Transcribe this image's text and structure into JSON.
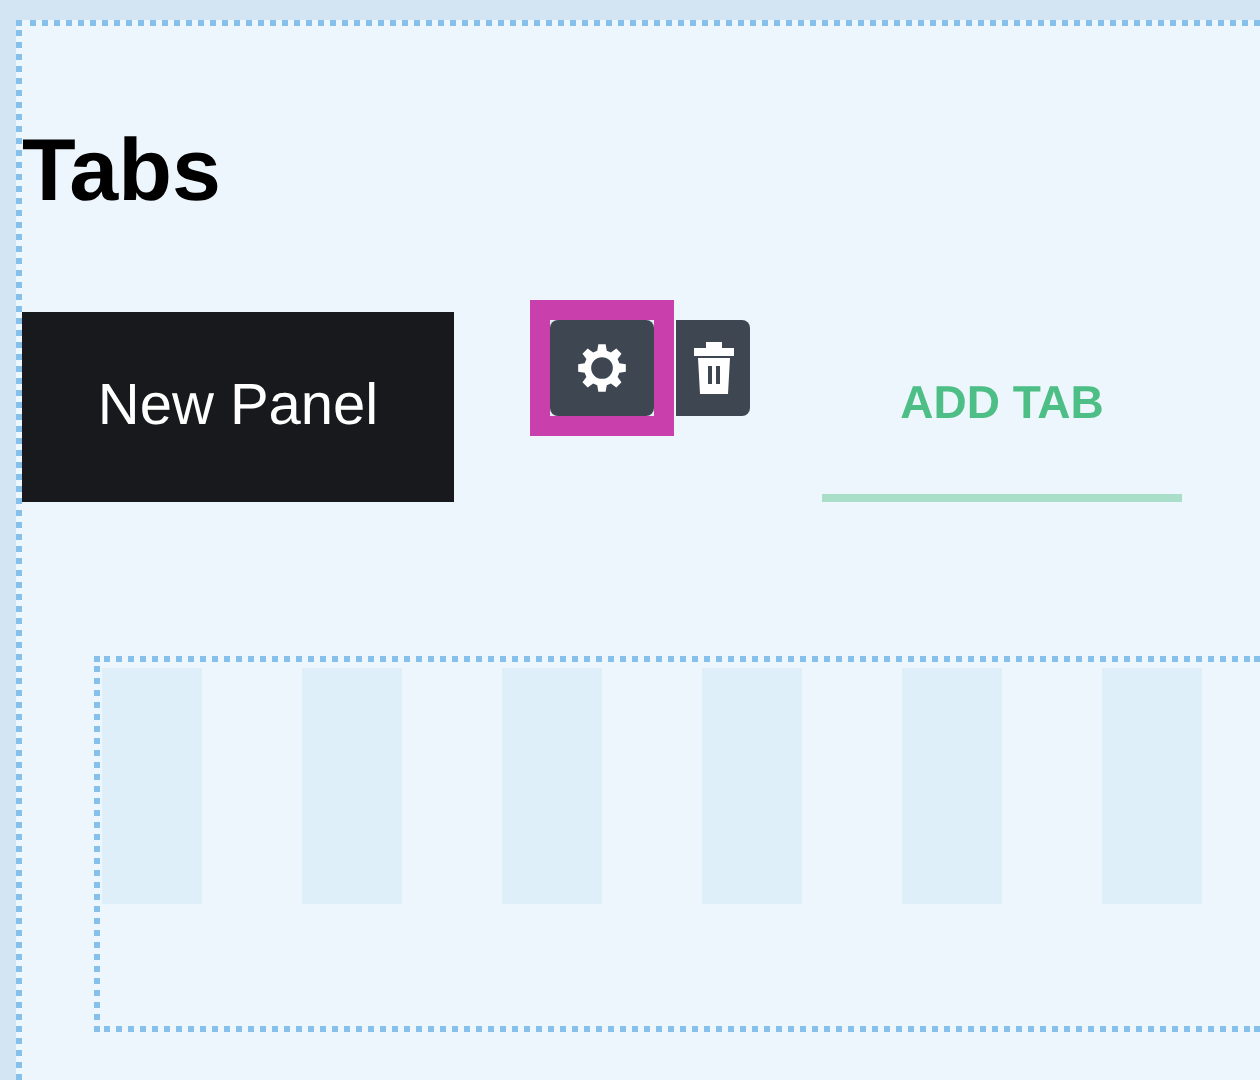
{
  "heading": "Tabs",
  "button": {
    "label": "New Panel"
  },
  "tools": [
    {
      "kind": "settings",
      "selected": true
    },
    {
      "kind": "delete",
      "selected": false
    }
  ],
  "tabs": [
    {
      "label": "ADD TAB",
      "selected": true
    }
  ]
}
